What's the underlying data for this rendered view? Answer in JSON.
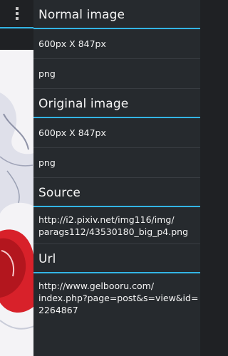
{
  "sections": [
    {
      "header": "Normal image",
      "rows": [
        "600px X 847px",
        "png"
      ]
    },
    {
      "header": "Original image",
      "rows": [
        "600px X 847px",
        "png"
      ]
    },
    {
      "header": "Source",
      "rows": [
        "http://i2.pixiv.net/img116/img/\nparags112/43530180_big_p4.png"
      ]
    },
    {
      "header": "Url",
      "rows": [
        "http://www.gelbooru.com/\nindex.php?page=post&s=view&id=\n2264867"
      ]
    }
  ],
  "colors": {
    "accent": "#33b5e5",
    "panel": "#262a2e",
    "divider": "#3a3e43"
  },
  "icons": [
    "overflow-menu-icon"
  ]
}
